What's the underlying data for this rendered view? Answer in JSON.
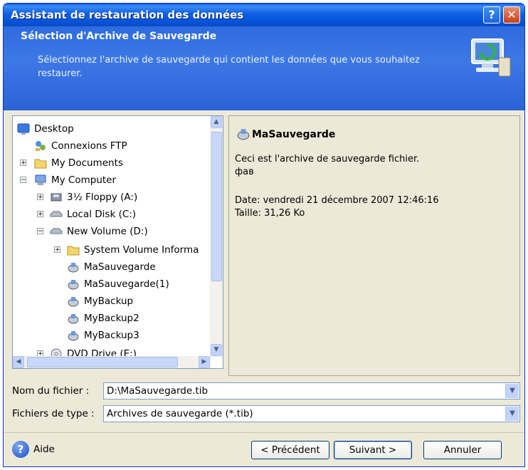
{
  "window": {
    "title": "Assistant de restauration des données"
  },
  "header": {
    "title": "Sélection d'Archive de Sauvegarde",
    "description": "Sélectionnez l'archive de sauvegarde qui contient les données que vous souhaitez restaurer."
  },
  "tree": {
    "items": [
      {
        "label": "Desktop",
        "icon": "desktop-icon"
      },
      {
        "label": "Connexions FTP",
        "icon": "ftp-icon"
      },
      {
        "label": "My Documents",
        "icon": "folder-icon"
      },
      {
        "label": "My Computer",
        "icon": "computer-icon"
      },
      {
        "label": "3½ Floppy (A:)",
        "icon": "floppy-icon"
      },
      {
        "label": "Local Disk (C:)",
        "icon": "disk-icon"
      },
      {
        "label": "New Volume (D:)",
        "icon": "disk-icon"
      },
      {
        "label": "System Volume Informa",
        "icon": "folder-icon"
      },
      {
        "label": "MaSauvegarde",
        "icon": "archive-icon"
      },
      {
        "label": "MaSauvegarde(1)",
        "icon": "archive-icon"
      },
      {
        "label": "MyBackup",
        "icon": "archive-icon"
      },
      {
        "label": "MyBackup2",
        "icon": "archive-icon"
      },
      {
        "label": "MyBackup3",
        "icon": "archive-icon"
      },
      {
        "label": "DVD Drive (E:)",
        "icon": "dvd-icon"
      }
    ]
  },
  "details": {
    "name": "MaSauvegarde",
    "description_line1": "Ceci est l'archive de sauvegarde fichier.",
    "description_line2": "фав",
    "date": "Date: vendredi 21 décembre 2007 12:46:16",
    "size": "Taille: 31,26 Ko"
  },
  "form": {
    "filename_label": "Nom du fichier :",
    "filename_value": "D:\\MaSauvegarde.tib",
    "filetype_label": "Fichiers de type :",
    "filetype_value": "Archives de sauvegarde (*.tib)"
  },
  "footer": {
    "help_label": "Aide",
    "back_label": "< Précédent",
    "next_label": "Suivant >",
    "cancel_label": "Annuler"
  },
  "colors": {
    "titlebar": "#0553D8",
    "header": "#2E6BE0",
    "dialog": "#ECE9D8"
  }
}
